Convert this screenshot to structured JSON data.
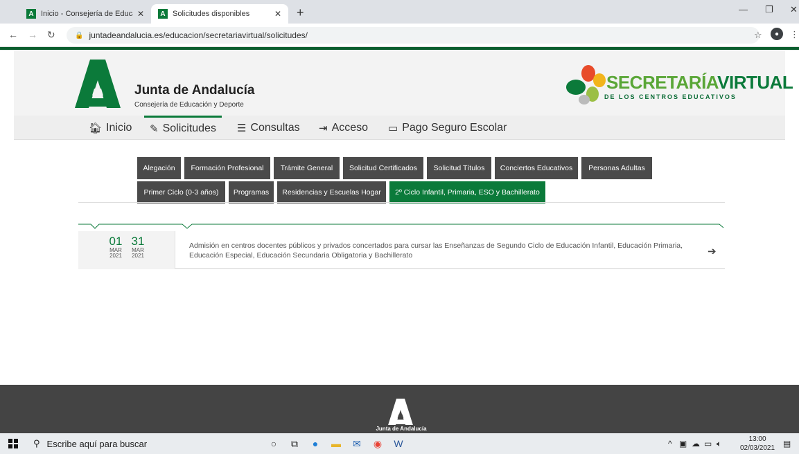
{
  "browser": {
    "tabs": [
      {
        "title": "Inicio - Consejería de Educación y",
        "favicon": "A"
      },
      {
        "title": "Solicitudes disponibles",
        "favicon": "A"
      }
    ],
    "url": "juntadeandalucia.es/educacion/secretariavirtual/solicitudes/"
  },
  "header": {
    "brand_title": "Junta de Andalucía",
    "brand_sub": "Consejería de Educación y Deporte",
    "sv_title_a": "SECRETARÍA",
    "sv_title_b": "VIRTUAL",
    "sv_sub": "DE LOS CENTROS EDUCATIVOS"
  },
  "menu": {
    "inicio": "Inicio",
    "solicitudes": "Solicitudes",
    "consultas": "Consultas",
    "acceso": "Acceso",
    "pago": "Pago Seguro Escolar"
  },
  "categories": {
    "row1": [
      "Alegación",
      "Formación Profesional",
      "Trámite General",
      "Solicitud Certificados",
      "Solicitud Títulos",
      "Conciertos Educativos",
      "Personas Adultas"
    ],
    "row2": [
      "Primer Ciclo (0-3 años)",
      "Programas",
      "Residencias y Escuelas Hogar",
      "2º Ciclo Infantil, Primaria, ESO y Bachillerato"
    ],
    "active": "2º Ciclo Infantil, Primaria, ESO y Bachillerato"
  },
  "entry": {
    "start": {
      "day": "01",
      "month": "MAR",
      "year": "2021"
    },
    "end": {
      "day": "31",
      "month": "MAR",
      "year": "2021"
    },
    "line1": "Admisión en centros docentes públicos y privados concertados para cursar las Enseñanzas de Segundo Ciclo de Educación Infantil, Educación Primaria,",
    "line2": "Educación Especial, Educación Secundaria Obligatoria y Bachillerato"
  },
  "footer": {
    "text": "Junta de Andalucía"
  },
  "taskbar": {
    "search_placeholder": "Escribe aquí para buscar",
    "time": "13:00",
    "date": "02/03/2021"
  },
  "colors": {
    "brand_green": "#0b7a3a",
    "dark_gray": "#4a4a4a",
    "footer": "#444444"
  }
}
